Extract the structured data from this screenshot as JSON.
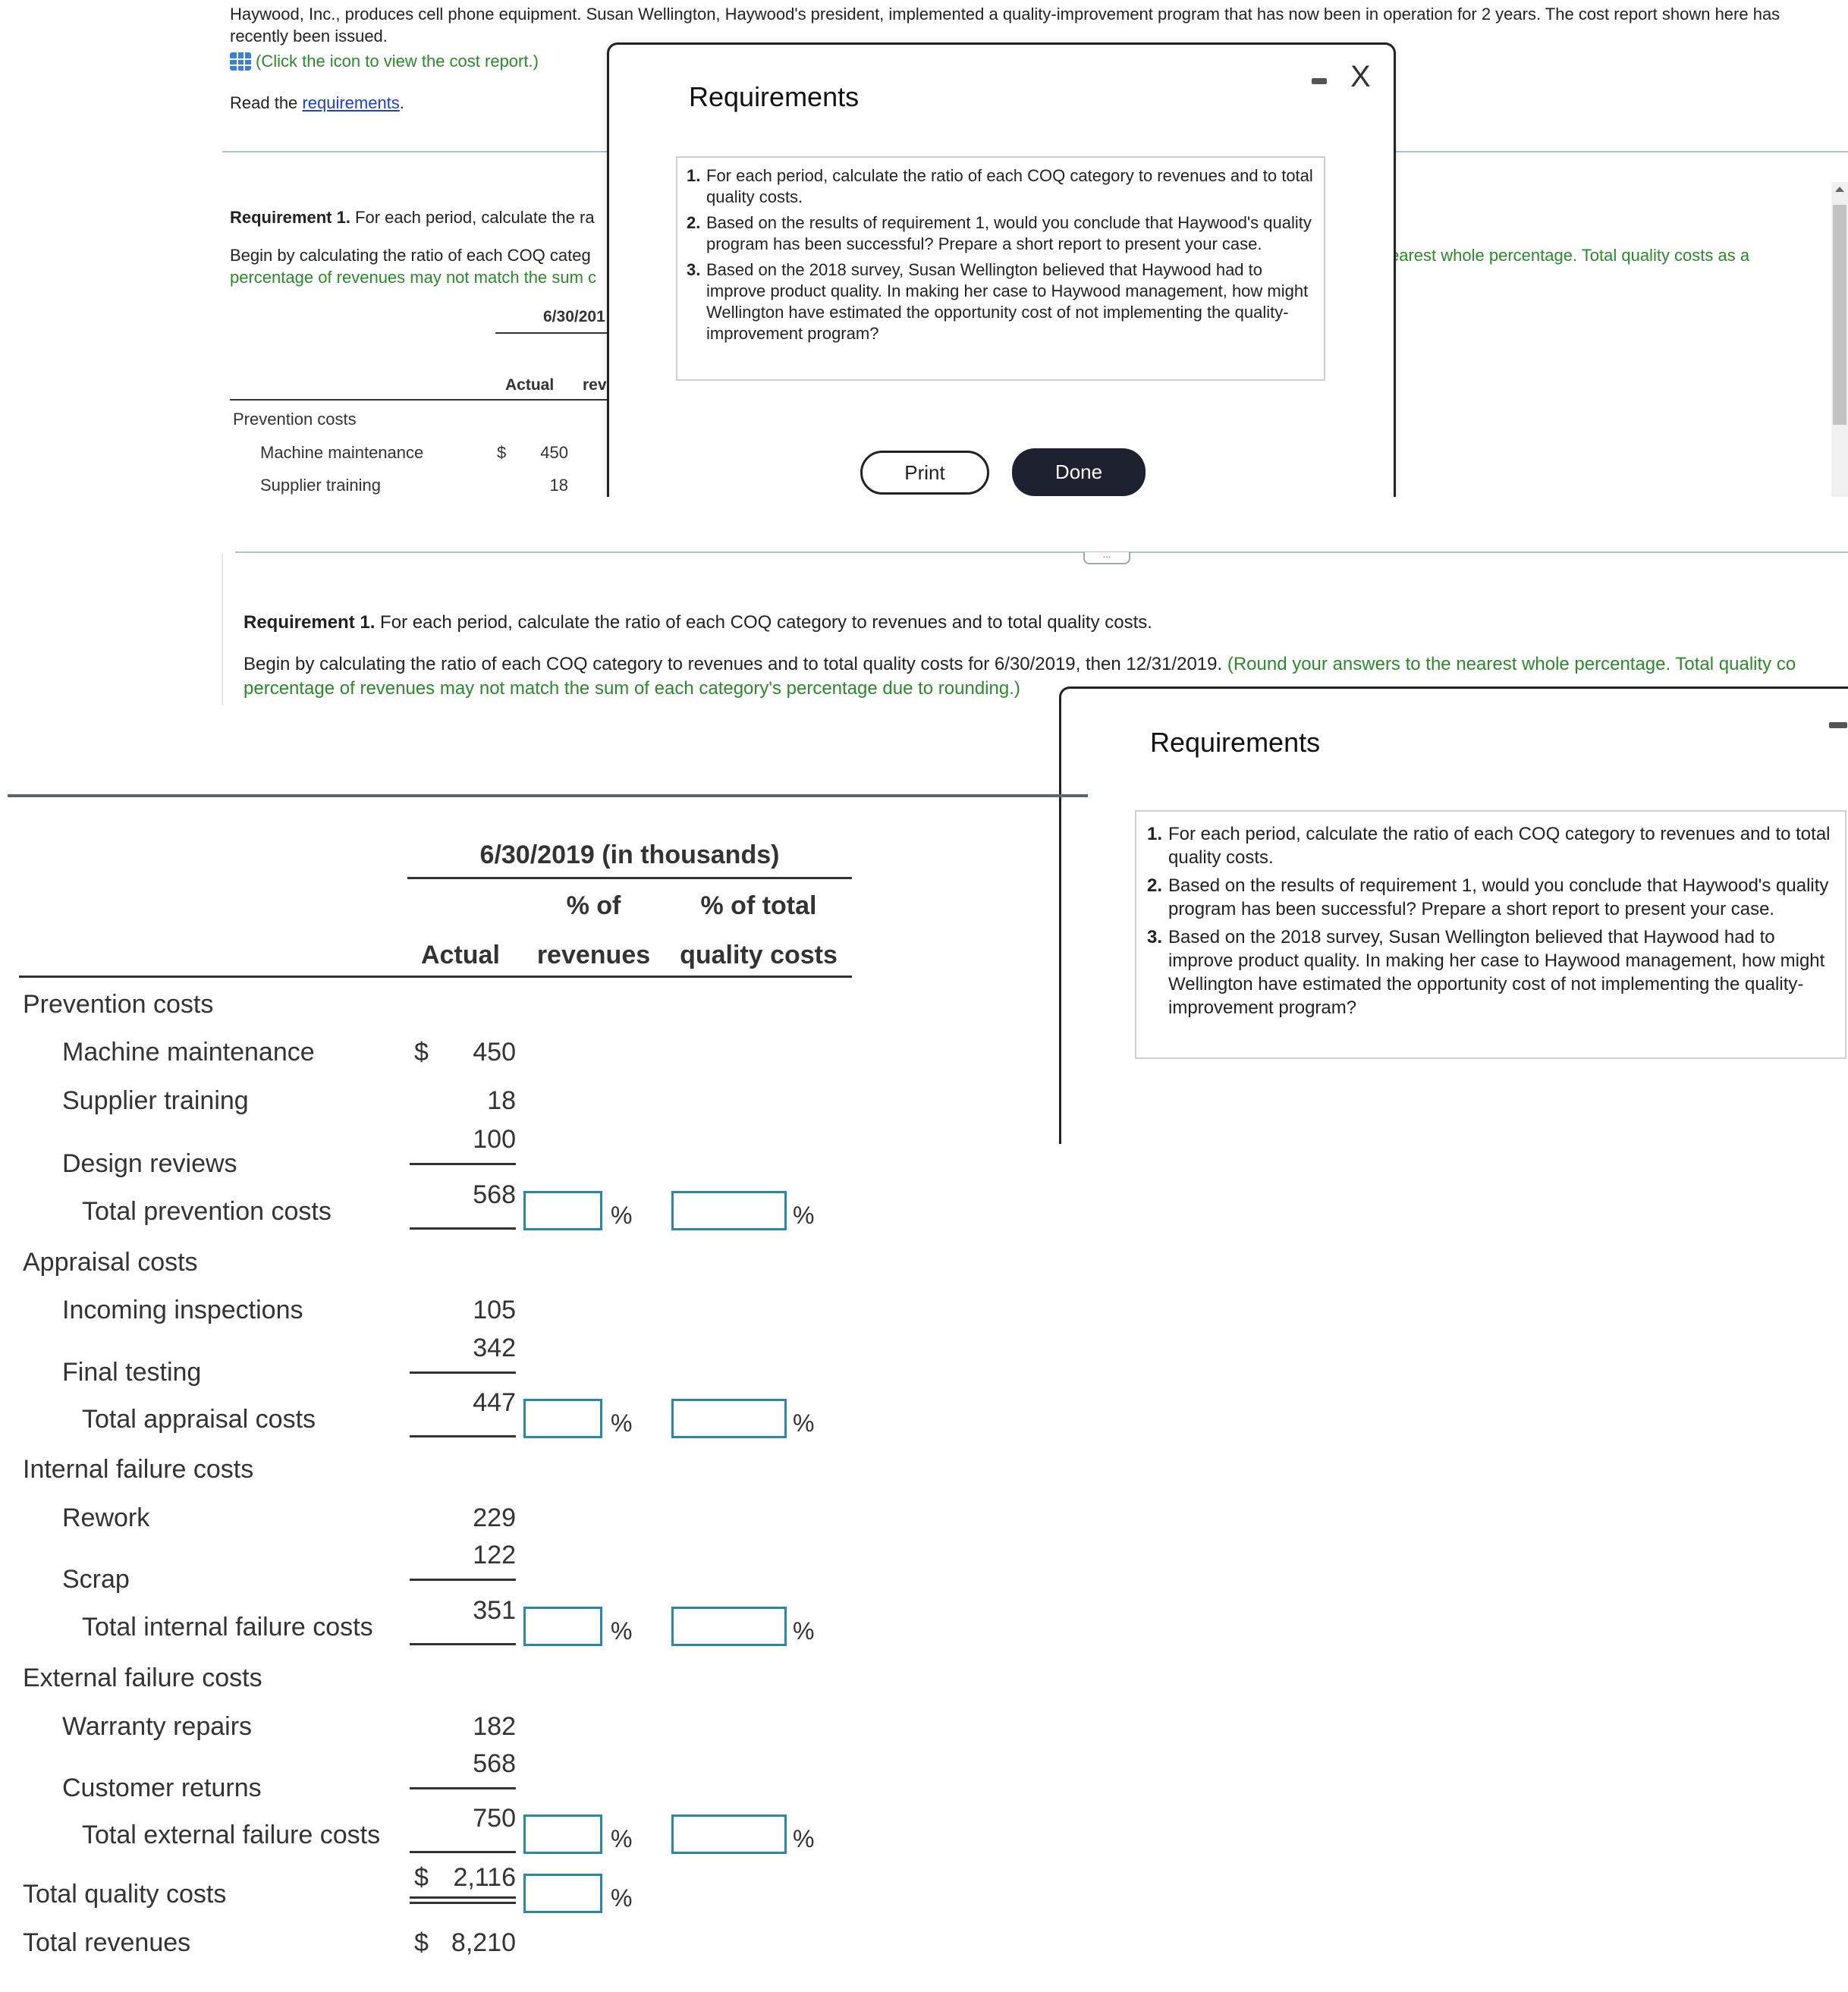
{
  "intro": {
    "line1": "Haywood, Inc., produces cell phone equipment. Susan Wellington, Haywood's president, implemented a quality-improvement program  that has now been in operation for 2 years. The cost report shown here has",
    "line2": "recently been issued.",
    "icon_link": "(Click the icon to view the cost report.)",
    "read_prefix": "Read the ",
    "read_link": "requirements",
    "read_suffix": "."
  },
  "top_requirement": {
    "label": "Requirement 1.",
    "text_visible": " For each period, calculate the ra",
    "begin_visible": "Begin by calculating the ratio of each COQ categ",
    "green_visible": "percentage of revenues may not match the sum c",
    "right_green_visible": "earest whole percentage. Total quality costs as a"
  },
  "top_table": {
    "period_header": "6/30/201",
    "actual_header": "Actual",
    "rev_header": "rev",
    "section": "Prevention costs",
    "rows": [
      {
        "label": "Machine maintenance",
        "currency": "$",
        "value": "450"
      },
      {
        "label": "Supplier training",
        "currency": "",
        "value": "18"
      }
    ]
  },
  "requirements_dialog": {
    "title": "Requirements",
    "minimize_icon": "minimize-icon",
    "close_icon": "close-icon",
    "close_label": "X",
    "items": [
      {
        "num": "1.",
        "text": "For each period, calculate the ratio of each COQ category to revenues and to total quality costs."
      },
      {
        "num": "2.",
        "text": "Based on the results of requirement 1, would you conclude that Haywood's quality program has been successful? Prepare a short report to present your case."
      },
      {
        "num": "3.",
        "text": "Based on the 2018 survey, Susan Wellington believed that Haywood had to improve product quality. In making her case to Haywood management, how might Wellington have estimated the opportunity cost of not implementing the quality-improvement program?"
      }
    ],
    "print_label": "Print",
    "done_label": "Done"
  },
  "drag_handle_label": "...",
  "main_requirement": {
    "label": "Requirement 1.",
    "text": " For each period, calculate the ratio of each COQ category to revenues and to total quality costs.",
    "begin": "Begin by calculating the ratio of each COQ category to revenues and to total quality costs for 6/30/2019, then 12/31/2019. ",
    "green1": "(Round your answers to the nearest whole percentage. Total quality co",
    "green2": "percentage of revenues may not match the sum of each category's percentage due to rounding.)"
  },
  "cost_table": {
    "period_header": "6/30/2019 (in thousands)",
    "col_actual": "Actual",
    "col_rev_1": "% of",
    "col_rev_2": "revenues",
    "col_tqc_1": "% of total",
    "col_tqc_2": "quality costs",
    "pct_sign": "%",
    "sections": [
      {
        "title": "Prevention costs",
        "items": [
          {
            "label": "Machine maintenance",
            "currency": "$",
            "value": "450"
          },
          {
            "label": "Supplier training",
            "currency": "",
            "value": "18"
          },
          {
            "label": "Design reviews",
            "currency": "",
            "value": "100"
          }
        ],
        "total_label": "Total prevention costs",
        "total_value": "568",
        "pct_revenues": "",
        "pct_total": ""
      },
      {
        "title": "Appraisal costs",
        "items": [
          {
            "label": "Incoming inspections",
            "currency": "",
            "value": "105"
          },
          {
            "label": "Final testing",
            "currency": "",
            "value": "342"
          }
        ],
        "total_label": "Total appraisal costs",
        "total_value": "447",
        "pct_revenues": "",
        "pct_total": ""
      },
      {
        "title": "Internal failure costs",
        "items": [
          {
            "label": "Rework",
            "currency": "",
            "value": "229"
          },
          {
            "label": "Scrap",
            "currency": "",
            "value": "122"
          }
        ],
        "total_label": "Total internal failure costs",
        "total_value": "351",
        "pct_revenues": "",
        "pct_total": ""
      },
      {
        "title": "External failure costs",
        "items": [
          {
            "label": "Warranty repairs",
            "currency": "",
            "value": "182"
          },
          {
            "label": "Customer returns",
            "currency": "",
            "value": "568"
          }
        ],
        "total_label": "Total external failure costs",
        "total_value": "750",
        "pct_revenues": "",
        "pct_total": ""
      }
    ],
    "total_quality": {
      "label": "Total quality costs",
      "currency": "$",
      "value": "2,116",
      "pct_revenues": ""
    },
    "total_revenues": {
      "label": "Total revenues",
      "currency": "$",
      "value": "8,210"
    }
  }
}
